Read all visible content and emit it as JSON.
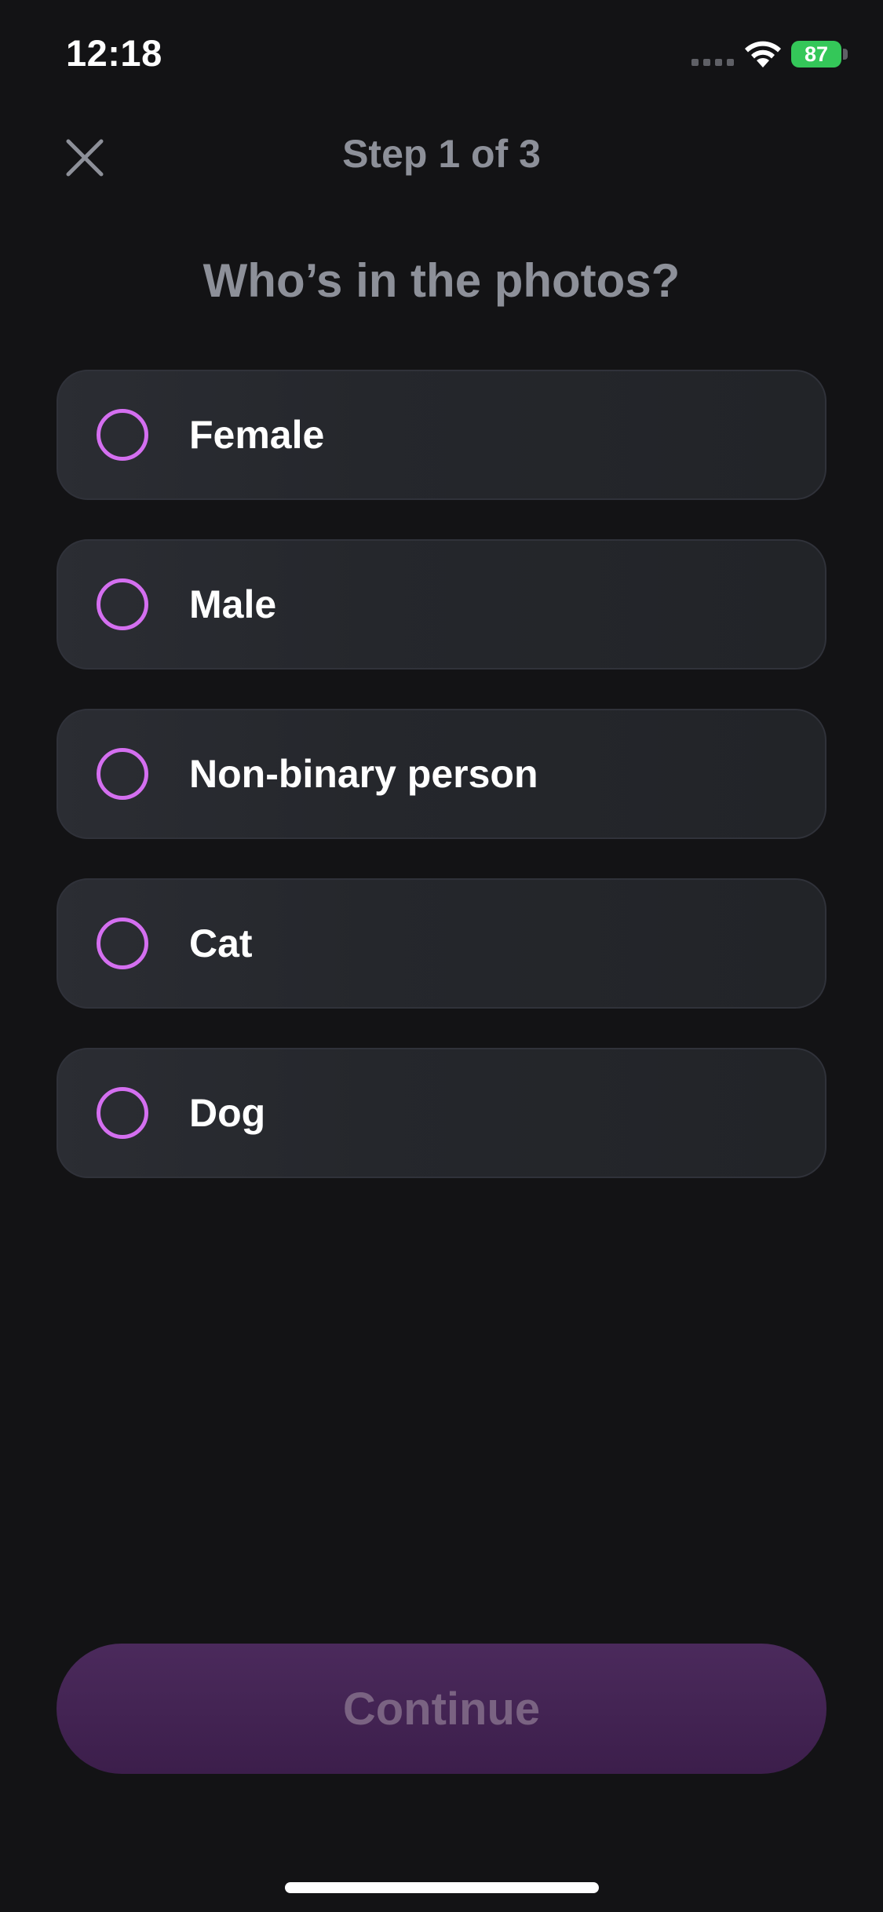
{
  "status_bar": {
    "time": "12:18",
    "battery": "87"
  },
  "header": {
    "step_title": "Step 1 of 3"
  },
  "question": "Who’s in the photos?",
  "options": [
    {
      "label": "Female"
    },
    {
      "label": "Male"
    },
    {
      "label": "Non-binary person"
    },
    {
      "label": "Cat"
    },
    {
      "label": "Dog"
    }
  ],
  "continue_label": "Continue",
  "colors": {
    "accent": "#d46ff0",
    "battery": "#34c759",
    "button": "#4b2a5c"
  }
}
